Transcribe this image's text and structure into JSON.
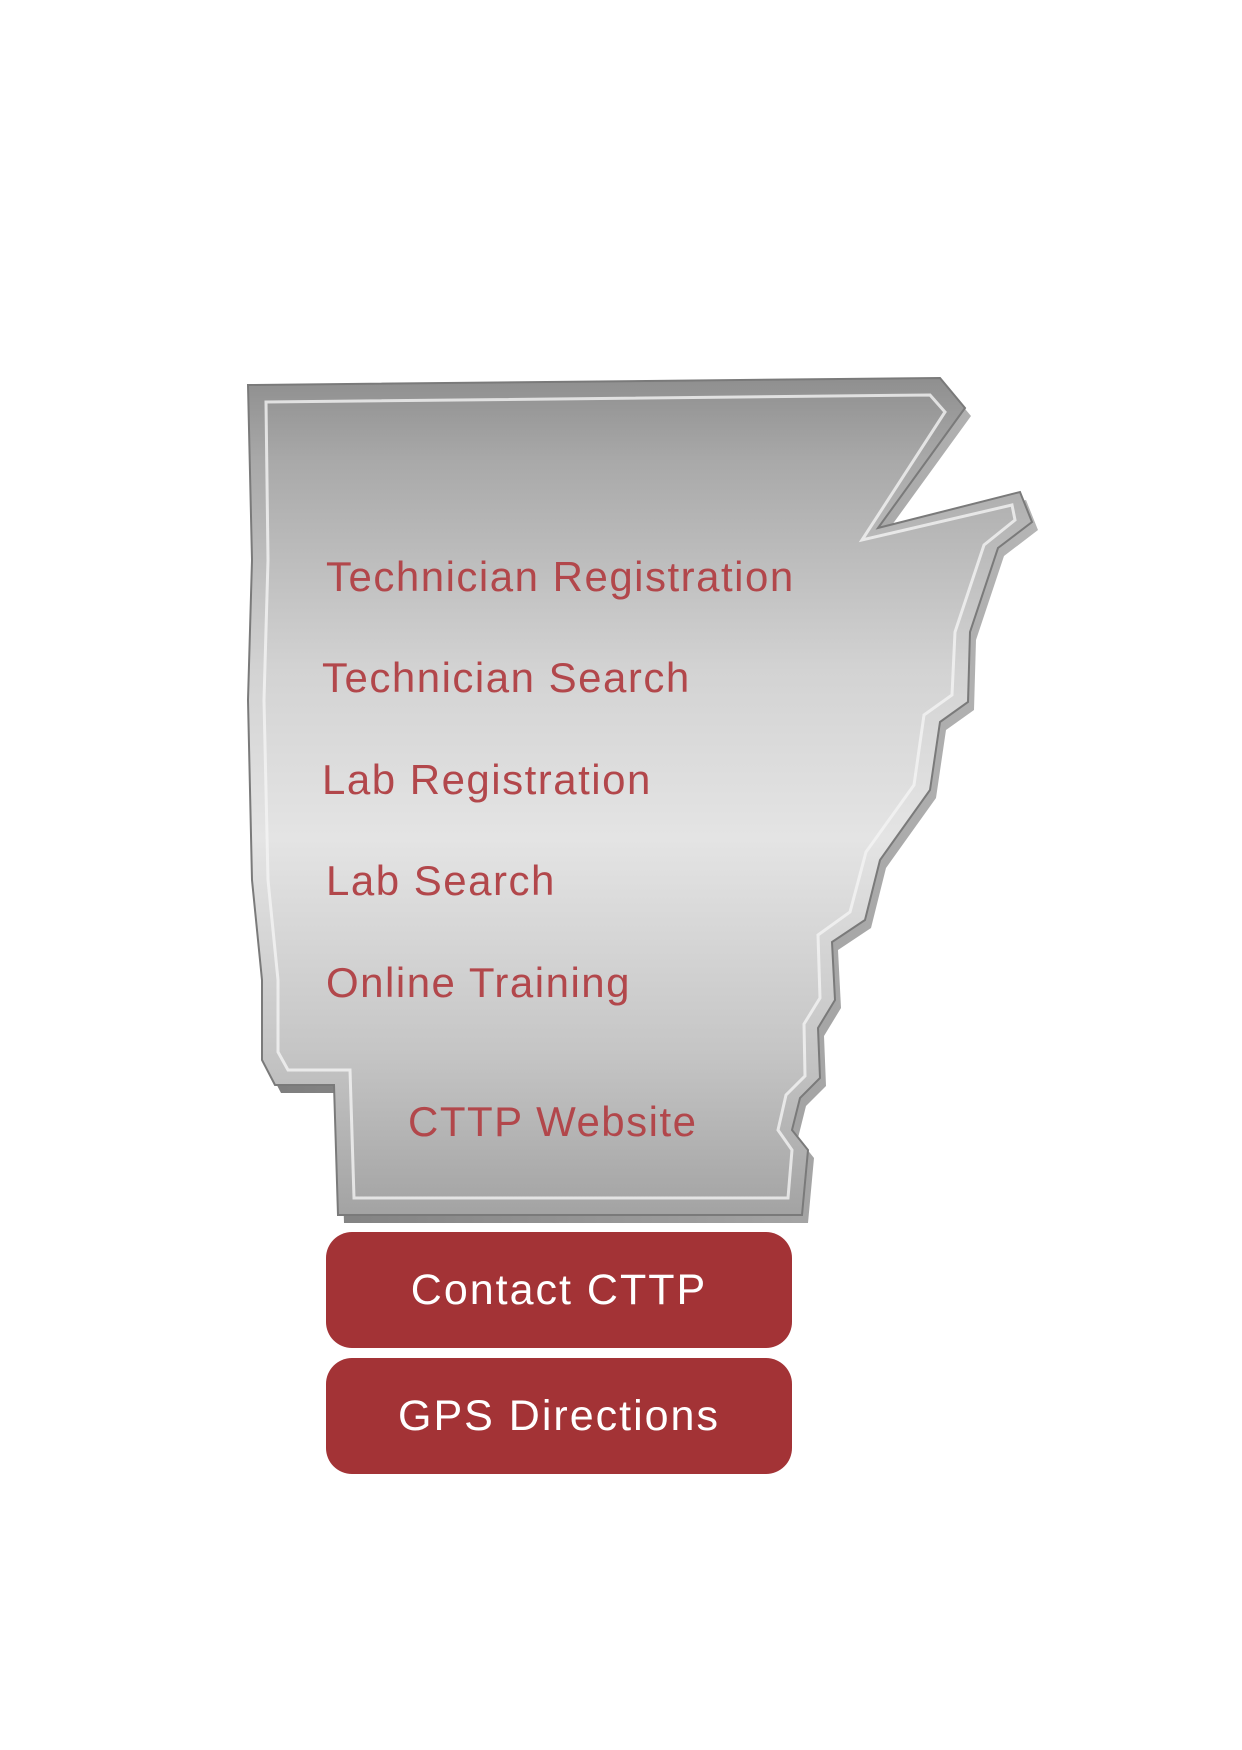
{
  "theme": {
    "accent": "#a33336",
    "link_color": "#b2474b",
    "map_light": "#e6e6e6",
    "map_dark": "#8e8e8e",
    "background": "#ffffff"
  },
  "map": {
    "icon": "arkansas-state-shape",
    "links": [
      {
        "label": "Technician Registration"
      },
      {
        "label": "Technician Search"
      },
      {
        "label": "Lab Registration"
      },
      {
        "label": "Lab Search"
      },
      {
        "label": "Online Training"
      },
      {
        "label": "CTTP Website"
      }
    ]
  },
  "buttons": {
    "contact_label": "Contact CTTP",
    "directions_label": "GPS Directions"
  }
}
